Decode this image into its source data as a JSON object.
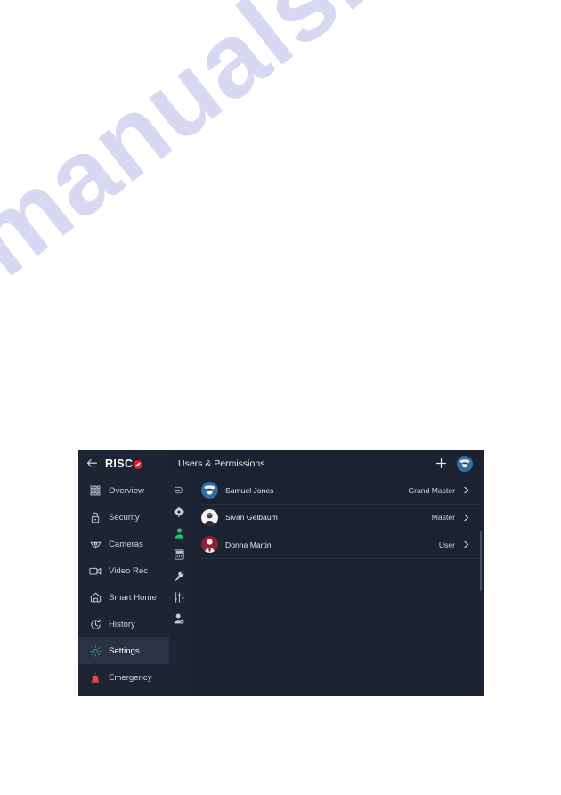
{
  "page": {
    "watermark": "manualshive.com",
    "background_color": "#ffffff"
  },
  "app": {
    "panel_bg": "#171d2b",
    "accent_green": "#1ea65a",
    "brand_red": "#d8222a",
    "brand": {
      "name": "RISC",
      "logo_icon": "risco-logo",
      "back_icon": "collapse-left-icon"
    },
    "sidebar": {
      "items": [
        {
          "label": "Overview",
          "icon": "grid-icon",
          "active": false
        },
        {
          "label": "Security",
          "icon": "lock-icon",
          "active": false
        },
        {
          "label": "Cameras",
          "icon": "dome-camera-icon",
          "active": false
        },
        {
          "label": "Video Rec",
          "icon": "video-camera-icon",
          "active": false
        },
        {
          "label": "Smart Home",
          "icon": "home-icon",
          "active": false
        },
        {
          "label": "History",
          "icon": "clock-icon",
          "active": false
        },
        {
          "label": "Settings",
          "icon": "gear-icon",
          "active": true
        },
        {
          "label": "Emergency",
          "icon": "siren-icon",
          "active": false
        }
      ]
    },
    "header": {
      "title": "Users & Permissions",
      "add_icon": "plus-icon",
      "avatar_icon": "user-avatar-icon"
    },
    "icon_rail": [
      {
        "icon": "list-arrow-icon",
        "active": false
      },
      {
        "icon": "gear-icon",
        "active": false
      },
      {
        "icon": "person-icon",
        "active": true
      },
      {
        "icon": "keypad-icon",
        "active": false
      },
      {
        "icon": "wrench-icon",
        "active": false
      },
      {
        "icon": "sliders-icon",
        "active": false
      },
      {
        "icon": "person-badge-icon",
        "active": false
      }
    ],
    "users": {
      "chevron_icon": "chevron-right-icon",
      "rows": [
        {
          "name": "Samuel Jones",
          "role": "Grand Master",
          "avatar": "avatar-samuel"
        },
        {
          "name": "Sivan Gelbaum",
          "role": "Master",
          "avatar": "avatar-sivan"
        },
        {
          "name": "Donna Martin",
          "role": "User",
          "avatar": "avatar-donna"
        }
      ]
    }
  }
}
